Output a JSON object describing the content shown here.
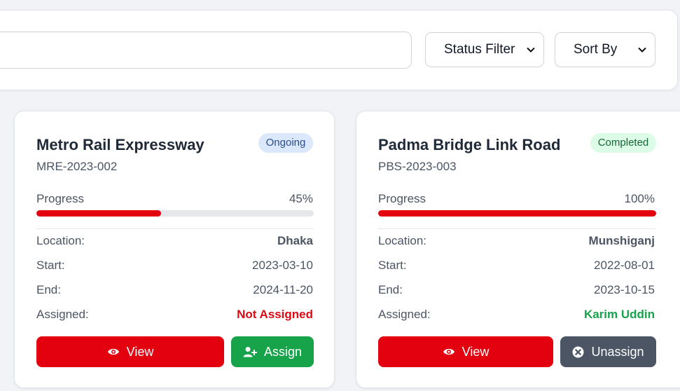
{
  "toolbar": {
    "search_value": "",
    "status_filter": "Status Filter",
    "sort_by": "Sort By"
  },
  "projects": [
    {
      "title": "Metro Rail Expressway",
      "code": "MRE-2023-002",
      "status": "Ongoing",
      "progress_label": "Progress",
      "progress_value": "45%",
      "progress_fraction": 0.45,
      "location_label": "Location:",
      "location": "Dhaka",
      "start_label": "Start:",
      "start": "2023-03-10",
      "end_label": "End:",
      "end": "2024-11-20",
      "assigned_label": "Assigned:",
      "assigned": "Not Assigned",
      "view_label": "View",
      "action_label": "Assign"
    },
    {
      "title": "Padma Bridge Link Road",
      "code": "PBS-2023-003",
      "status": "Completed",
      "progress_label": "Progress",
      "progress_value": "100%",
      "progress_fraction": 1.0,
      "location_label": "Location:",
      "location": "Munshiganj",
      "start_label": "Start:",
      "start": "2022-08-01",
      "end_label": "End:",
      "end": "2023-10-15",
      "assigned_label": "Assigned:",
      "assigned": "Karim Uddin",
      "view_label": "View",
      "action_label": "Unassign"
    }
  ],
  "colors": {
    "primary_red": "#e3000f",
    "assign_green": "#16a34a",
    "unassign_gray": "#4b5563",
    "not_assigned_red": "#dc0a12",
    "assigned_green": "#16a34a",
    "badge_ongoing_bg": "#dbe7fb",
    "badge_ongoing_text": "#2c4f8c",
    "badge_completed_bg": "#dcfce7",
    "badge_completed_text": "#166534"
  },
  "icons": {
    "view": "eye-icon",
    "assign": "user-plus-icon",
    "unassign": "circle-x-icon",
    "select": "chevron-down-icon"
  }
}
